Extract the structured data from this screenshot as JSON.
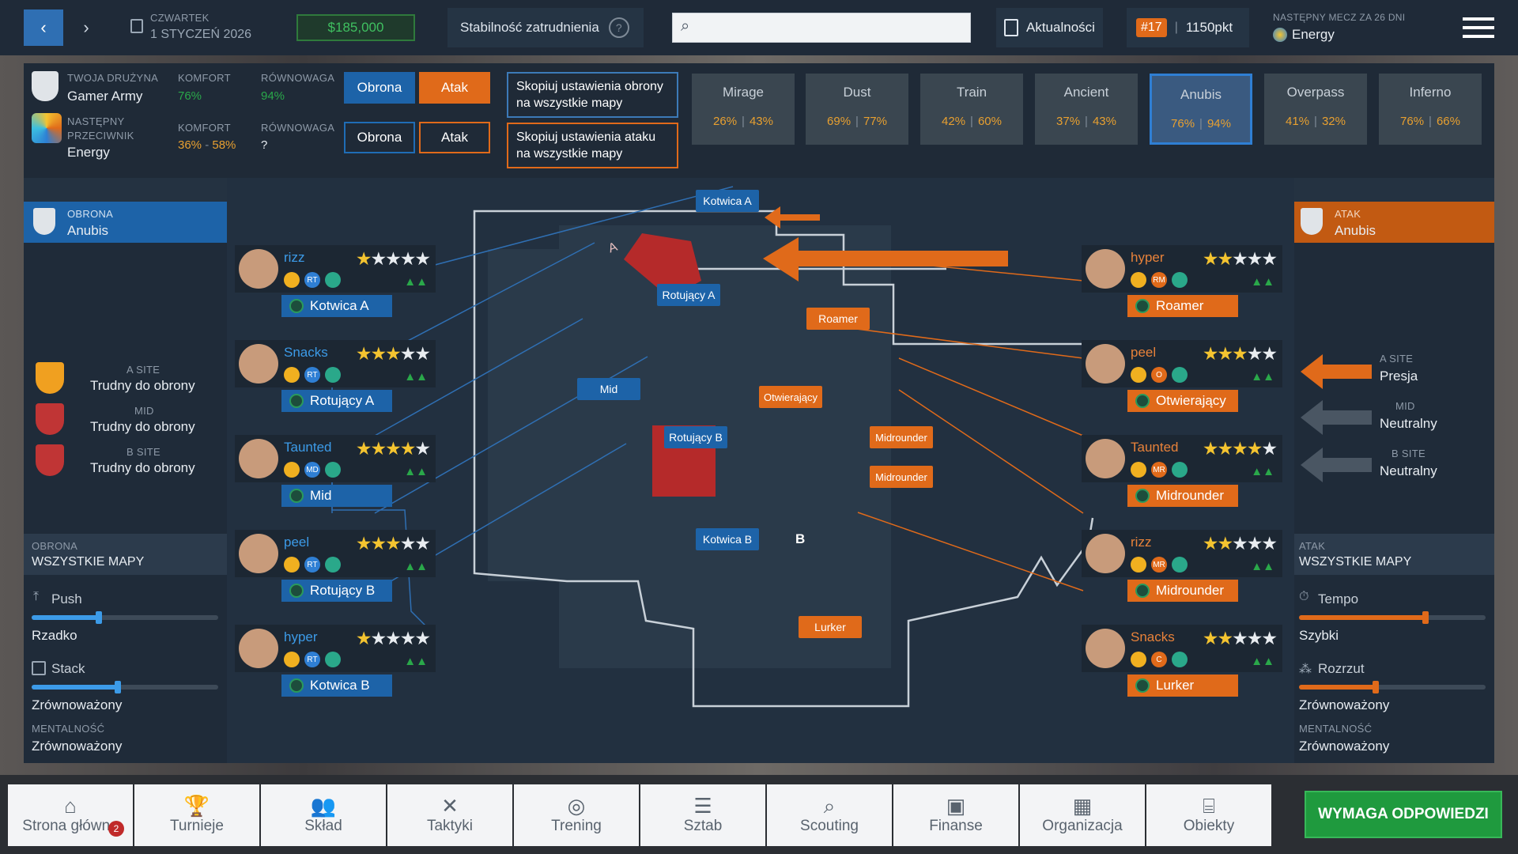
{
  "topbar": {
    "day": "CZWARTEK",
    "date": "1 STYCZEŃ 2026",
    "money": "$185,000",
    "stability": "Stabilność zatrudnienia",
    "help": "?",
    "news": "Aktualności",
    "rank": "#17",
    "points": "1150pkt",
    "next_match_label": "NASTĘPNY MECZ ZA 26 DNI",
    "next_match_team": "Energy"
  },
  "header": {
    "your_team_label": "TWOJA DRUŻYNA",
    "your_team": "Gamer Army",
    "comfort_label": "KOMFORT",
    "balance_label": "RÓWNOWAGA",
    "your_comfort": "76%",
    "your_balance": "94%",
    "opp_label": "NASTĘPNY PRZECIWNIK",
    "opp_team": "Energy",
    "opp_comfort_a": "36%",
    "opp_comfort_sep": "-",
    "opp_comfort_b": "58%",
    "opp_balance": "?",
    "defense": "Obrona",
    "attack": "Atak",
    "copy_def": "Skopiuj ustawienia obrony na wszystkie mapy",
    "copy_att": "Skopiuj ustawienia ataku na wszystkie mapy"
  },
  "maps": [
    {
      "name": "Mirage",
      "a": "26%",
      "b": "43%"
    },
    {
      "name": "Dust",
      "a": "69%",
      "b": "77%"
    },
    {
      "name": "Train",
      "a": "42%",
      "b": "60%"
    },
    {
      "name": "Ancient",
      "a": "37%",
      "b": "43%"
    },
    {
      "name": "Anubis",
      "a": "76%",
      "b": "94%"
    },
    {
      "name": "Overpass",
      "a": "41%",
      "b": "32%"
    },
    {
      "name": "Inferno",
      "a": "76%",
      "b": "66%"
    }
  ],
  "map_sep": "|",
  "left": {
    "side_label": "OBRONA",
    "map": "Anubis",
    "a_site_label": "A SITE",
    "a_site_val": "Trudny do obrony",
    "mid_label": "MID",
    "mid_val": "Trudny do obrony",
    "b_site_label": "B SITE",
    "b_site_val": "Trudny do obrony",
    "all_label": "OBRONA",
    "all_maps": "WSZYSTKIE MAPY",
    "push_label": "Push",
    "push_val": "Rzadko",
    "push_level": 0.36,
    "stack_label": "Stack",
    "stack_val": "Zrównoważony",
    "stack_level": 0.46,
    "mentality_label": "MENTALNOŚĆ",
    "mentality_val": "Zrównoważony"
  },
  "right": {
    "side_label": "ATAK",
    "map": "Anubis",
    "a_site_label": "A SITE",
    "a_site_val": "Presja",
    "mid_label": "MID",
    "mid_val": "Neutralny",
    "b_site_label": "B SITE",
    "b_site_val": "Neutralny",
    "all_label": "ATAK",
    "all_maps": "WSZYSTKIE MAPY",
    "tempo_label": "Tempo",
    "tempo_val": "Szybki",
    "tempo_level": 0.68,
    "spread_label": "Rozrzut",
    "spread_val": "Zrównoważony",
    "spread_level": 0.41,
    "mentality_label": "MENTALNOŚĆ",
    "mentality_val": "Zrównoważony"
  },
  "def_players": [
    {
      "name": "rizz",
      "stars": "★★★★★",
      "rating": 1,
      "badges": [
        "RT"
      ],
      "role": "Kotwica A"
    },
    {
      "name": "Snacks",
      "stars": "★★★★★",
      "rating": 2.5,
      "badges": [
        "RT"
      ],
      "role": "Rotujący A"
    },
    {
      "name": "Taunted",
      "stars": "★★★★★",
      "rating": 4,
      "badges": [
        "MD"
      ],
      "role": "Mid"
    },
    {
      "name": "peel",
      "stars": "★★★★★",
      "rating": 3,
      "badges": [
        "RT"
      ],
      "role": "Rotujący B"
    },
    {
      "name": "hyper",
      "stars": "★★★★★",
      "rating": 1,
      "badges": [
        "RT"
      ],
      "role": "Kotwica B"
    }
  ],
  "att_players": [
    {
      "name": "hyper",
      "stars": "★★★★★",
      "rating": 1.5,
      "badges": [
        "RM"
      ],
      "role": "Roamer"
    },
    {
      "name": "peel",
      "stars": "★★★★★",
      "rating": 3,
      "badges": [
        "O"
      ],
      "role": "Otwierający"
    },
    {
      "name": "Taunted",
      "stars": "★★★★★",
      "rating": 4,
      "badges": [
        "MR"
      ],
      "role": "Midrounder"
    },
    {
      "name": "rizz",
      "stars": "★★★★★",
      "rating": 2,
      "badges": [
        "MR"
      ],
      "role": "Midrounder"
    },
    {
      "name": "Snacks",
      "stars": "★★★★★",
      "rating": 2,
      "badges": [
        "C"
      ],
      "role": "Lurker"
    }
  ],
  "map_labels": {
    "kotwica_a": "Kotwica A",
    "rotujacy_a": "Rotujący A",
    "mid": "Mid",
    "rotujacy_b": "Rotujący B",
    "kotwica_b": "Kotwica B",
    "roamer": "Roamer",
    "otwierajacy": "Otwierający",
    "midrounder1": "Midrounder",
    "midrounder2": "Midrounder",
    "lurker": "Lurker",
    "site_a": "A",
    "site_b": "B"
  },
  "nav": [
    {
      "label": "Strona główna",
      "icon": "⌂"
    },
    {
      "label": "Turnieje",
      "icon": "🏆"
    },
    {
      "label": "Skład",
      "icon": "👥"
    },
    {
      "label": "Taktyki",
      "icon": "✕"
    },
    {
      "label": "Trening",
      "icon": "◎"
    },
    {
      "label": "Sztab",
      "icon": "☰"
    },
    {
      "label": "Scouting",
      "icon": "⌕"
    },
    {
      "label": "Finanse",
      "icon": "▣"
    },
    {
      "label": "Organizacja",
      "icon": "▦"
    },
    {
      "label": "Obiekty",
      "icon": "⌸"
    }
  ],
  "notif_count": "2",
  "cta": "WYMAGA ODPOWIEDZI",
  "colors": {
    "accent_blue": "#1d63a8",
    "accent_orange": "#e06a1a",
    "green": "#2aa84a"
  }
}
